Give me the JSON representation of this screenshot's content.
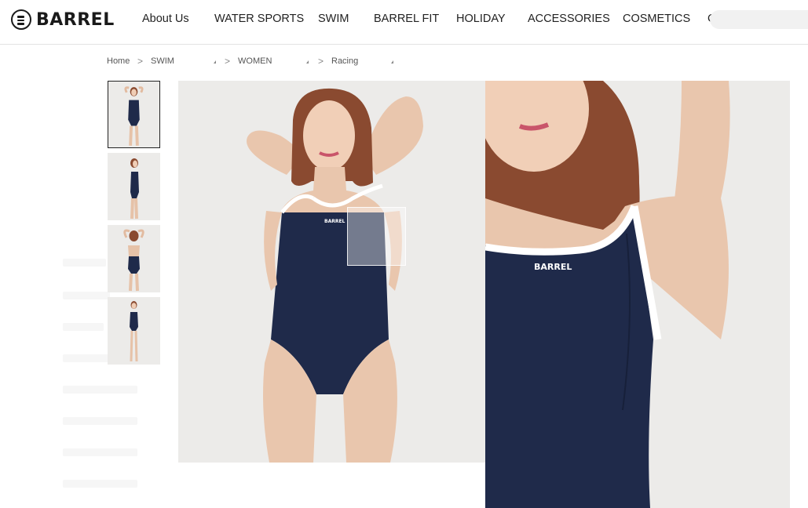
{
  "brand": {
    "name": "BARREL"
  },
  "nav": {
    "items": [
      {
        "label": "About Us"
      },
      {
        "label": "WATER SPORTS"
      },
      {
        "label": "SWIM"
      },
      {
        "label": "BARREL FIT"
      },
      {
        "label": "HOLIDAY"
      },
      {
        "label": "ACCESSORIES"
      },
      {
        "label": "COSMETICS"
      },
      {
        "label": "C"
      }
    ]
  },
  "breadcrumb": {
    "items": [
      {
        "label": "Home"
      },
      {
        "label": "SWIM"
      },
      {
        "label": "WOMEN"
      },
      {
        "label": "Racing"
      }
    ],
    "separator": ">"
  },
  "product": {
    "garment_logo": "BARREL",
    "thumbnails": [
      {
        "view": "front-arms-up",
        "selected": true
      },
      {
        "view": "side"
      },
      {
        "view": "back"
      },
      {
        "view": "full-body"
      }
    ]
  },
  "colors": {
    "swimsuit": "#1f2a4a",
    "trim": "#ffffff",
    "background": "#ecebe9",
    "accent_text": "#222222"
  },
  "icons": {
    "logo": "menu-circle-icon",
    "dropdown": "caret-down-icon"
  }
}
